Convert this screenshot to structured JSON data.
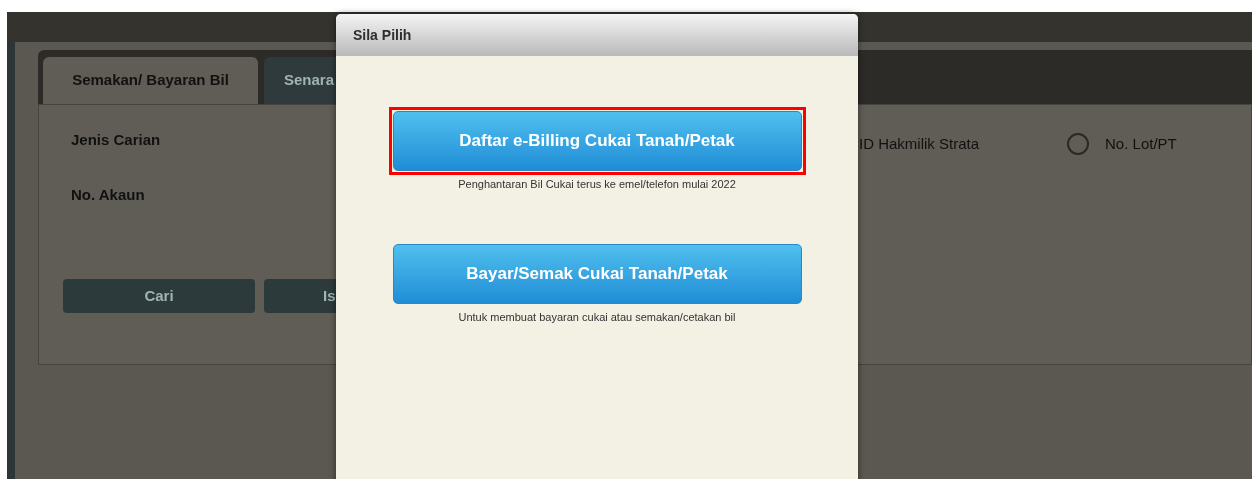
{
  "background": {
    "tabs": [
      {
        "label": "Semakan/ Bayaran Bil",
        "selected": true
      },
      {
        "label": "Senara",
        "selected": false
      }
    ],
    "fields": [
      {
        "label": "Jenis Carian"
      },
      {
        "label": "No. Akaun"
      }
    ],
    "options": [
      {
        "label": "ID Hakmilik Strata",
        "kind": "text"
      },
      {
        "label": "No. Lot/PT",
        "kind": "radio",
        "checked": false
      }
    ],
    "buttons": [
      "Cari",
      "Is"
    ]
  },
  "dialog": {
    "title": "Sila Pilih",
    "choices": [
      {
        "label": "Daftar e-Billing Cukai Tanah/Petak",
        "note": "Penghantaran Bil Cukai terus ke emel/telefon mulai 2022",
        "highlighted": true
      },
      {
        "label": "Bayar/Semak Cukai Tanah/Petak",
        "note": "Untuk membuat bayaran cukai atau semakan/cetakan bil",
        "highlighted": false
      }
    ]
  }
}
